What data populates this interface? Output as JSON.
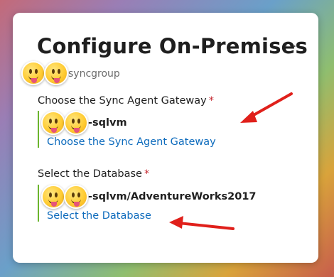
{
  "panel": {
    "title": "Configure On-Premises",
    "more_label": "...",
    "subtitle": "syncgroup"
  },
  "gateway": {
    "label": "Choose the Sync Agent Gateway",
    "required_mark": "*",
    "value": "-sqlvm",
    "link": "Choose the Sync Agent Gateway"
  },
  "database": {
    "label": "Select the Database",
    "required_mark": "*",
    "value": "-sqlvm/AdventureWorks2017",
    "link": "Select the Database"
  },
  "colors": {
    "link": "#0f6cbd",
    "required": "#c4262e",
    "accent_bar": "#6bb52e",
    "annotation_arrow": "#e0201b"
  }
}
